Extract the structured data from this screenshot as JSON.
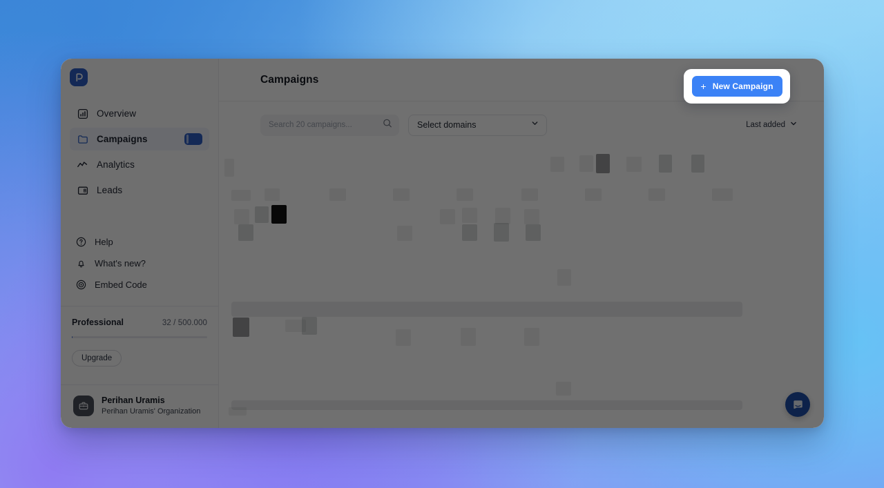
{
  "window": {
    "brand_logo_icon": "app-logo-p-mark"
  },
  "sidebar": {
    "nav": [
      {
        "label": "Overview",
        "icon": "chart-bar-icon",
        "active": false,
        "badge": null
      },
      {
        "label": "Campaigns",
        "icon": "folder-icon",
        "active": true,
        "badge": ""
      },
      {
        "label": "Analytics",
        "icon": "trend-line-icon",
        "active": false,
        "badge": null
      },
      {
        "label": "Leads",
        "icon": "contact-card-icon",
        "active": false,
        "badge": null
      }
    ],
    "secondary": [
      {
        "label": "Help",
        "icon": "question-circle-icon"
      },
      {
        "label": "What's new?",
        "icon": "bell-icon"
      },
      {
        "label": "Embed Code",
        "icon": "broadcast-icon"
      }
    ],
    "plan": {
      "name": "Professional",
      "usage": "32 / 500.000",
      "progress_percent": 0,
      "upgrade_label": "Upgrade"
    },
    "account": {
      "name": "Perihan Uramis",
      "organization": "Perihan Uramis' Organization",
      "avatar_icon": "briefcase-icon"
    }
  },
  "header": {
    "title": "Campaigns",
    "new_campaign_label": "New Campaign",
    "new_campaign_icon": "plus-icon",
    "accent_color": "#3b82f6"
  },
  "toolbar": {
    "search_placeholder": "Search 20 campaigns...",
    "search_value": "",
    "search_icon": "search-icon",
    "domain_select_label": "Select domains",
    "domain_select_icon": "chevron-down-icon",
    "sort_label": "Last added",
    "sort_icon": "chevron-down-icon"
  },
  "chat": {
    "launcher_icon": "intercom-chat-icon"
  }
}
